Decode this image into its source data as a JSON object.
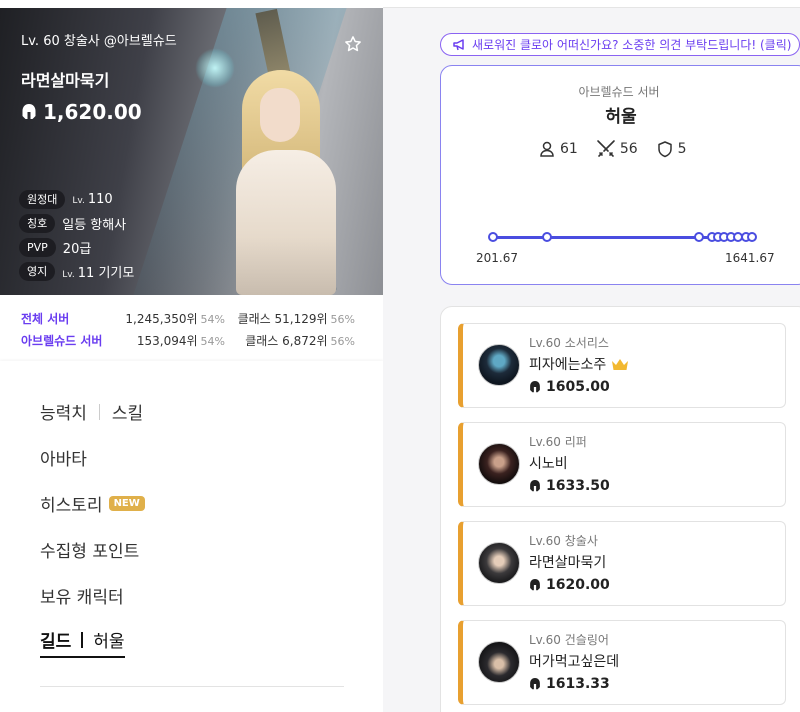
{
  "character": {
    "subtitle": "Lv. 60 창술사 @아브렐슈드",
    "name": "라면살마묵기",
    "item_level": "1,620.00",
    "tags": [
      {
        "label": "원정대",
        "prefix": "Lv.",
        "value": "110"
      },
      {
        "label": "칭호",
        "prefix": "",
        "value": "일등 항해사"
      },
      {
        "label": "PVP",
        "prefix": "",
        "value": "20급"
      },
      {
        "label": "영지",
        "prefix": "Lv.",
        "value": "11 기기모"
      }
    ]
  },
  "ranks": [
    {
      "label": "전체 서버",
      "rank": "1,245,350위",
      "rank_pct": "54%",
      "class_rank": "클래스 51,129위",
      "class_pct": "56%"
    },
    {
      "label": "아브렐슈드 서버",
      "rank": "153,094위",
      "rank_pct": "54%",
      "class_rank": "클래스 6,872위",
      "class_pct": "56%"
    }
  ],
  "menu": {
    "stats": "능력치",
    "skills": "스킬",
    "avatar": "아바타",
    "history": "히스토리",
    "history_badge": "NEW",
    "collectibles": "수집형 포인트",
    "characters": "보유 캐릭터",
    "guild_label": "길드",
    "guild_value": "허울"
  },
  "notice": "새로워진 클로아 어떠신가요? 소중한 의견 부탁드립니다! (클릭)",
  "guild": {
    "server": "아브렐슈드 서버",
    "name": "허울",
    "members": "61",
    "battles": "56",
    "defense": "5",
    "min": "201.67",
    "max": "1641.67"
  },
  "members": [
    {
      "class": "Lv.60 소서리스",
      "name": "피자에는소주",
      "score": "1605.00",
      "crown": true
    },
    {
      "class": "Lv.60 리퍼",
      "name": "시노비",
      "score": "1633.50",
      "crown": false
    },
    {
      "class": "Lv.60 창술사",
      "name": "라면살마묵기",
      "score": "1620.00",
      "crown": false
    },
    {
      "class": "Lv.60 건슬링어",
      "name": "머가먹고싶은데",
      "score": "1613.33",
      "crown": false
    }
  ],
  "colors": {
    "accent": "#6a3df0",
    "member_border": "#e8a030",
    "range": "#4a4de0"
  }
}
